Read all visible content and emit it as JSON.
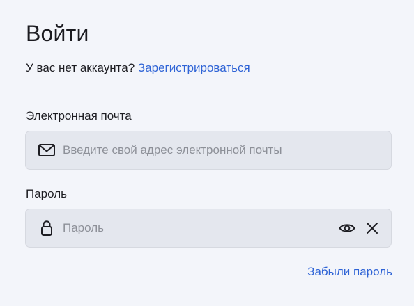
{
  "form": {
    "title": "Войти",
    "no_account_text": "У вас нет аккаунта?",
    "signup_link": "Зарегистрироваться",
    "email": {
      "label": "Электронная почта",
      "placeholder": "Введите свой адрес электронной почты",
      "value": "",
      "icon": "mail-icon"
    },
    "password": {
      "label": "Пароль",
      "placeholder": "Пароль",
      "value": "",
      "icon": "lock-icon",
      "show_icon": "eye-icon",
      "clear_icon": "close-icon"
    },
    "forgot_link": "Забыли пароль"
  },
  "colors": {
    "background": "#f3f5fa",
    "input_background": "#e4e7ee",
    "link": "#2f64d6",
    "text": "#1d1d22",
    "placeholder": "#8d9098"
  }
}
